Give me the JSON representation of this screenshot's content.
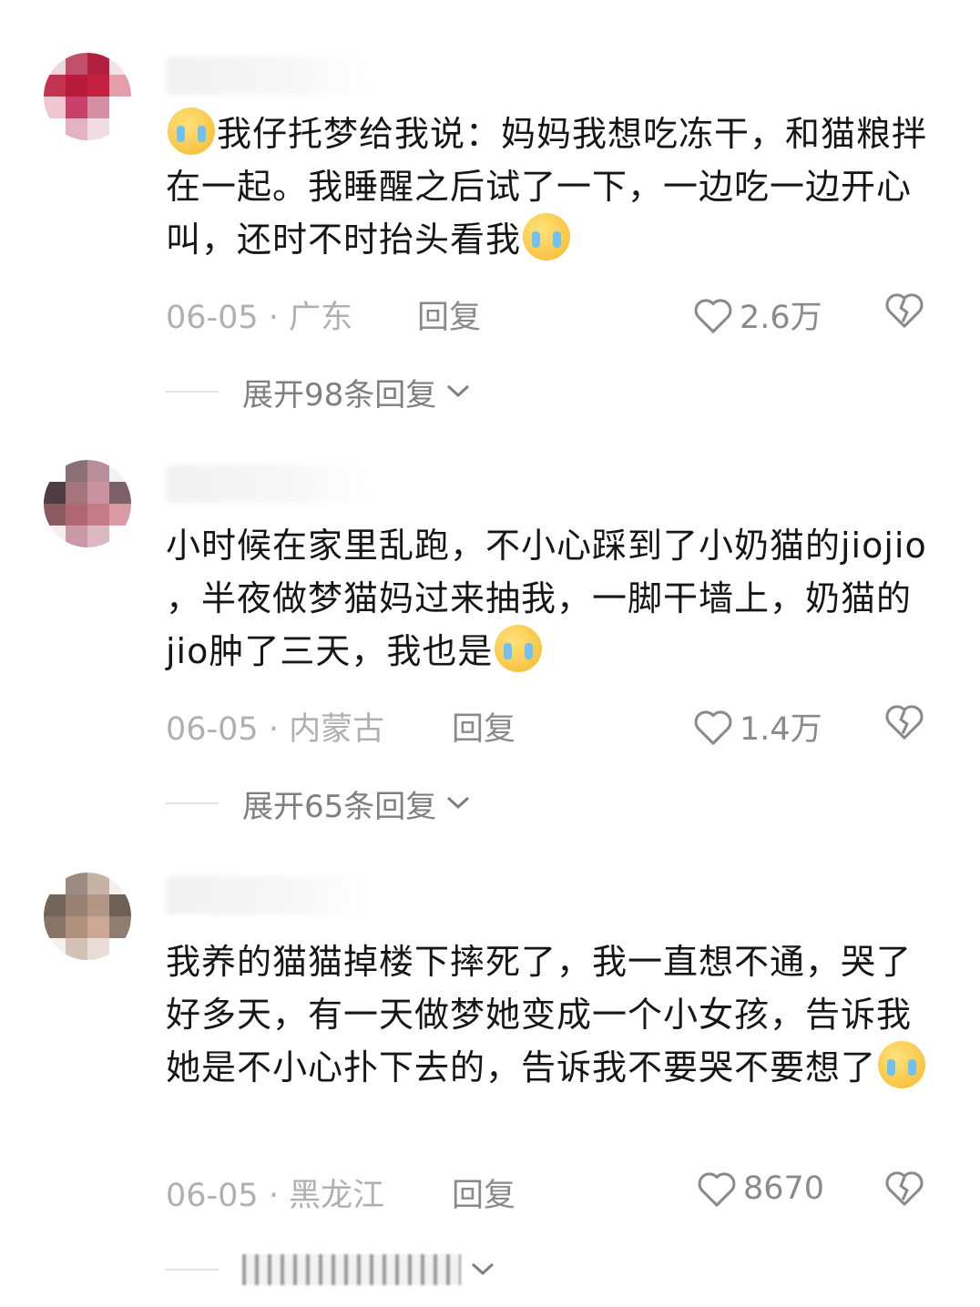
{
  "comments": [
    {
      "text": "我仔托梦给我说：妈妈我想吃冻干，和猫粮拌在一起。我睡醒之后试了一下，一边吃一边开心叫，还时不时抬头看我",
      "emoji_lead": "loudly-crying-face",
      "emoji_trail": "loudly-crying-face",
      "date": "06-05 · 广东",
      "reply_label": "回复",
      "likes": "2.6万",
      "expand_label": "展开98条回复"
    },
    {
      "text": "小时候在家里乱跑，不小心踩到了小奶猫的jiojio ，半夜做梦猫妈过来抽我，一脚干墙上，奶猫的jio肿了三天，我也是",
      "emoji_trail": "broken-heart-face",
      "date": "06-05 · 内蒙古",
      "reply_label": "回复",
      "likes": "1.4万",
      "expand_label": "展开65条回复"
    },
    {
      "text": "我养的猫猫掉楼下摔死了，我一直想不通，哭了好多天，有一天做梦她变成一个小女孩，告诉我她是不小心扑下去的，告诉我不要哭不要想了",
      "emoji_trail": "holding-back-tears-face",
      "date": "06-05 · 黑龙江",
      "reply_label": "回复",
      "likes": "8670"
    }
  ],
  "icons": {
    "like": "heart-outline-icon",
    "dislike": "broken-heart-icon",
    "expand": "chevron-down-icon"
  },
  "colors": {
    "meta": "#b0b0b0",
    "action": "#8a8a8a",
    "text": "#161616"
  }
}
